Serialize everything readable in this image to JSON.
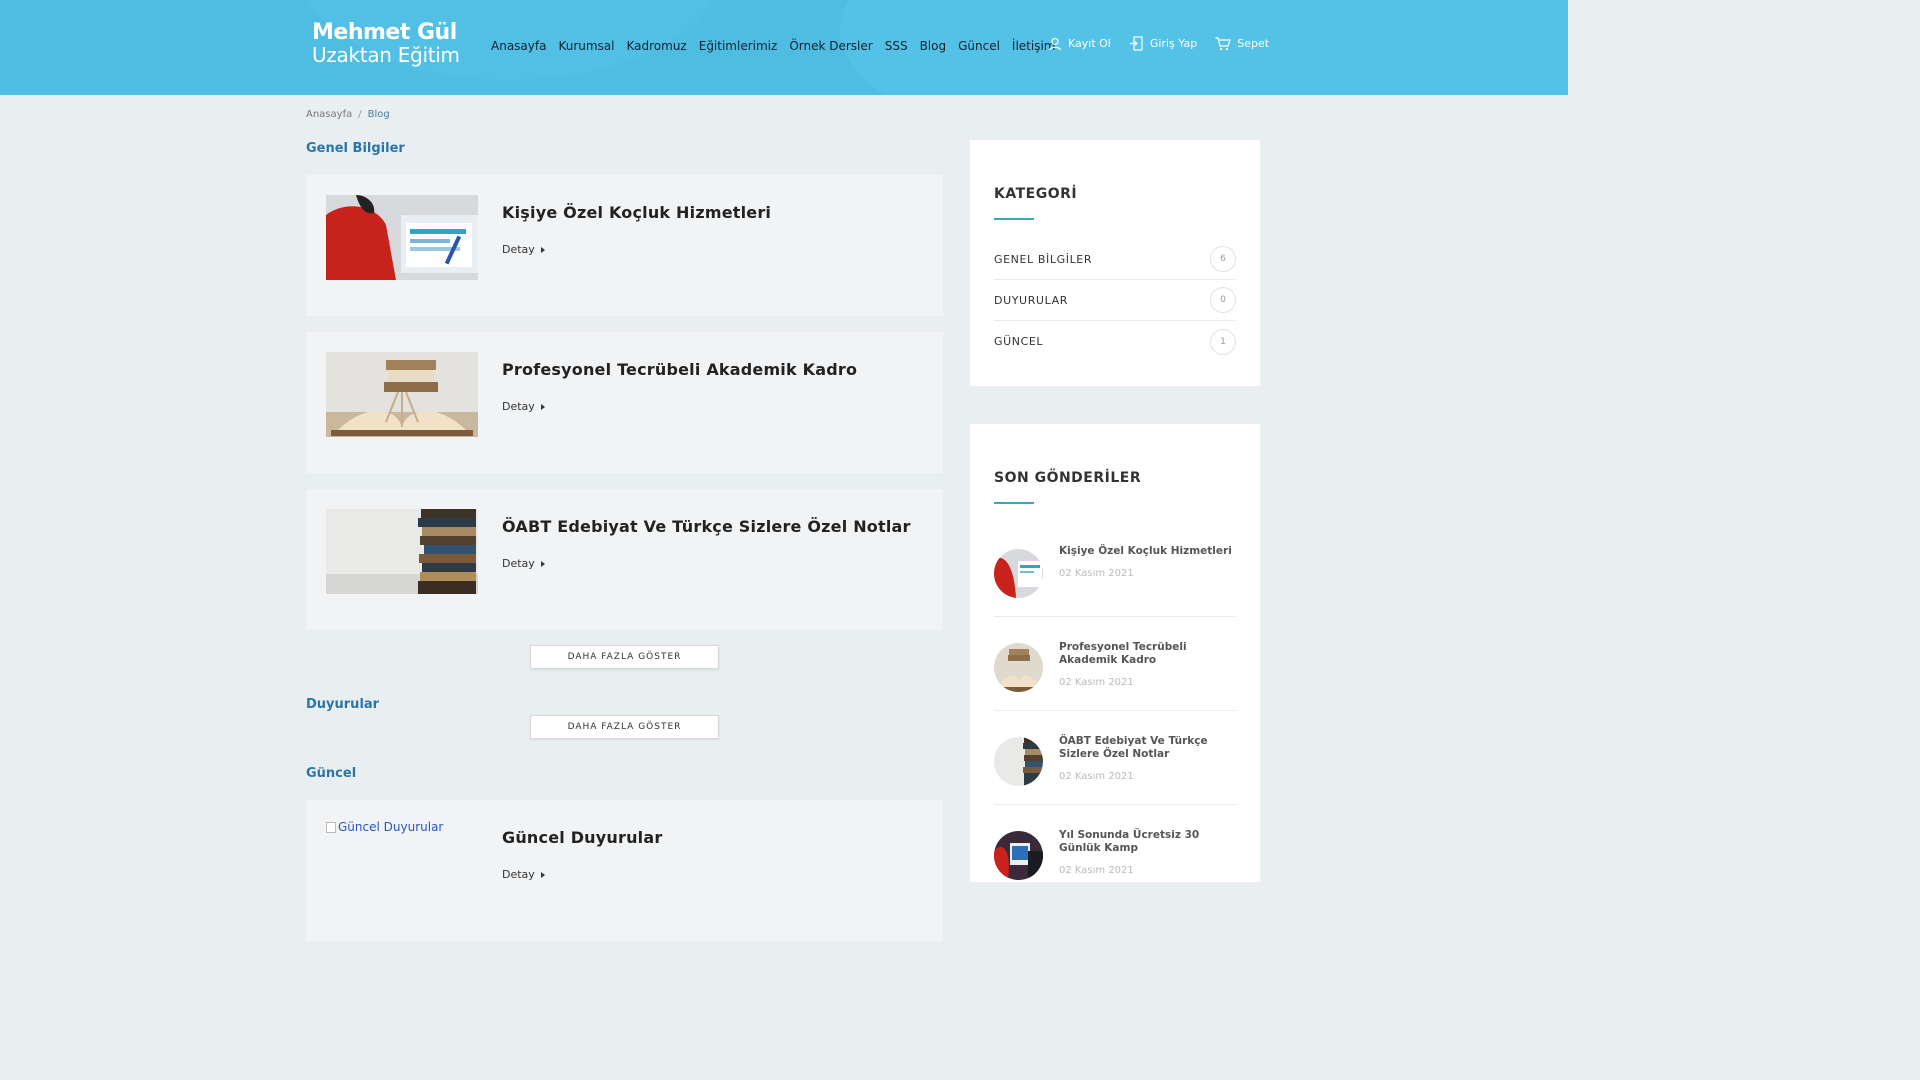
{
  "header": {
    "logo_line1": "Mehmet Gül",
    "logo_line2": "Uzaktan Eğitim",
    "nav": [
      "Anasayfa",
      "Kurumsal",
      "Kadromuz",
      "Eğitimlerimiz",
      "Örnek Dersler",
      "SSS",
      "Blog",
      "Güncel",
      "İletişim"
    ],
    "register": "Kayıt Ol",
    "login": "Giriş Yap",
    "cart": "Sepet"
  },
  "breadcrumb": {
    "home": "Anasayfa",
    "sep": "/",
    "current": "Blog"
  },
  "sections": {
    "genel": "Genel Bilgiler",
    "duyurular": "Duyurular",
    "guncel": "Güncel"
  },
  "posts": [
    {
      "title": "Kişiye Özel Koçluk Hizmetleri",
      "detail": "Detay"
    },
    {
      "title": "Profesyonel Tecrübeli Akademik Kadro",
      "detail": "Detay"
    },
    {
      "title": "ÖABT Edebiyat Ve Türkçe Sizlere Özel Notlar",
      "detail": "Detay"
    },
    {
      "title": "Güncel Duyurular",
      "detail": "Detay",
      "img_alt": "Güncel Duyurular"
    }
  ],
  "more_button": "DAHA FAZLA GÖSTER",
  "sidebar": {
    "category_title": "KATEGORİ",
    "categories": [
      {
        "name": "GENEL BİLGİLER",
        "count": "6"
      },
      {
        "name": "DUYURULAR",
        "count": "0"
      },
      {
        "name": "GÜNCEL",
        "count": "1"
      }
    ],
    "recent_title": "SON GÖNDERİLER",
    "recent": [
      {
        "title": "Kişiye Özel Koçluk Hizmetleri",
        "date": "02 Kasım 2021"
      },
      {
        "title": "Profesyonel Tecrübeli Akademik Kadro",
        "date": "02 Kasım 2021"
      },
      {
        "title": "ÖABT Edebiyat Ve Türkçe Sizlere Özel Notlar",
        "date": "02 Kasım 2021"
      },
      {
        "title": "Yıl Sonunda Ücretsiz 30 Günlük Kamp",
        "date": "02 Kasım 2021"
      }
    ]
  },
  "colors": {
    "header_bg": "#4fbde2",
    "accent_blue": "#2a76a8",
    "accent_teal": "#3aa6b9"
  }
}
